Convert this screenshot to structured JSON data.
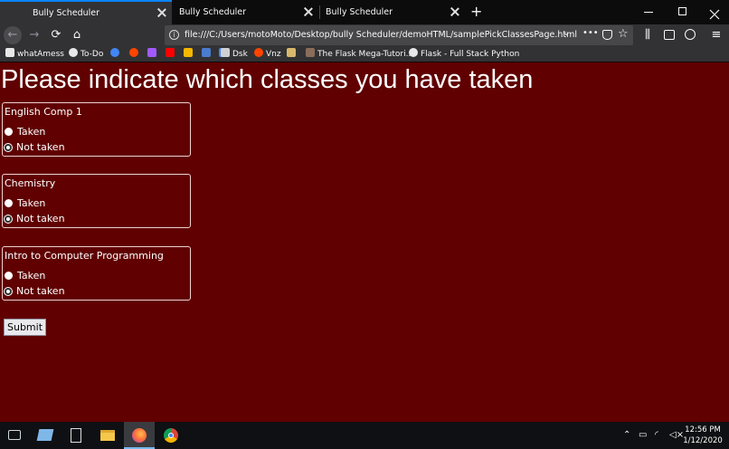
{
  "browser": {
    "tabs": [
      {
        "title": "Bully Scheduler",
        "active": true
      },
      {
        "title": "Bully Scheduler",
        "active": false
      },
      {
        "title": "Bully Scheduler",
        "active": false
      }
    ],
    "url": "file:///C:/Users/motoMoto/Desktop/bully Scheduler/demoHTML/samplePickClassesPage.html",
    "bookmarks": [
      {
        "label": "whatAmess",
        "color": "#e8e8e8"
      },
      {
        "label": "To-Do",
        "color": "#e8e8e8"
      },
      {
        "label": "",
        "color": "#4285f4"
      },
      {
        "label": "",
        "color": "#ff4500"
      },
      {
        "label": "",
        "color": "#a259ff"
      },
      {
        "label": "",
        "color": "#ff0000"
      },
      {
        "label": "",
        "color": "#f5b800"
      },
      {
        "label": "",
        "color": "#4a7bd0"
      },
      {
        "label": "",
        "color": "#4285f4"
      },
      {
        "label": "Dsk",
        "color": "#d0d0d0"
      },
      {
        "label": "Vnz",
        "color": "#ff4500"
      },
      {
        "label": "",
        "color": "#d8b86a"
      },
      {
        "label": "The Flask Mega-Tutori...",
        "color": "#8a6d5a"
      },
      {
        "label": "Flask - Full Stack Python",
        "color": "#e8e8e8"
      }
    ]
  },
  "page": {
    "title": "Please indicate which classes you have taken",
    "classes": [
      {
        "name": "English Comp 1",
        "options": [
          "Taken",
          "Not taken"
        ],
        "checked": 1
      },
      {
        "name": "Chemistry",
        "options": [
          "Taken",
          "Not taken"
        ],
        "checked": 1
      },
      {
        "name": "Intro to Computer Programming",
        "options": [
          "Taken",
          "Not taken"
        ],
        "checked": 1
      }
    ],
    "submit_label": "Submit"
  },
  "taskbar": {
    "time": "12:56 PM",
    "date": "1/12/2020"
  },
  "colors": {
    "page_background": "#600000",
    "accent": "#0a84ff"
  }
}
